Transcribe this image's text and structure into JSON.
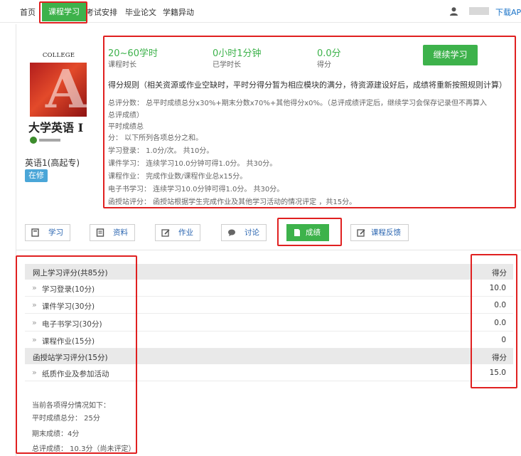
{
  "nav": {
    "items": [
      {
        "label": "首页"
      },
      {
        "label": "课程学习"
      },
      {
        "label": "考试安排"
      },
      {
        "label": "毕业论文"
      },
      {
        "label": "学籍异动"
      }
    ],
    "download": "下载APP"
  },
  "course": {
    "cover_header": "COLLEGE ENGLISH",
    "cover_letter": "A",
    "cover_title": "大学英语 I",
    "name": "英语1(高起专)",
    "status": "在修"
  },
  "stats": [
    {
      "value": "20~60学时",
      "label": "课程时长"
    },
    {
      "value": "0小时1分钟",
      "label": "已学时长"
    },
    {
      "value": "0.0分",
      "label": "得分"
    }
  ],
  "continue_label": "继续学习",
  "rules": {
    "title": "得分规则（相关资源或作业空缺时，平时分得分暂为相应模块的满分，待资源建设好后，成绩将重新按照规则计算）",
    "lines": [
      "总评分数：      总平时成绩总分x30%+期末分数x70%+其他得分x0%。（总评成绩评定后，继续学习会保存记录但不再算入",
      "总评成绩）",
      "平时成绩总",
      "分：              以下所列各项总分之和。",
      "学习登录：      1.0分/次。 共10分。",
      "课件学习：      连续学习10.0分钟可得1.0分。 共30分。",
      "课程作业：      完成作业数/课程作业总x15分。",
      "电子书学习：   连续学习10.0分钟可得1.0分。 共30分。",
      "函授站评分：   函授站根据学生完成作业及其他学习活动的情况评定 ，共15分。"
    ]
  },
  "tabs": [
    {
      "label": "学习"
    },
    {
      "label": "资料"
    },
    {
      "label": "作业"
    },
    {
      "label": "讨论"
    },
    {
      "label": "成绩"
    },
    {
      "label": "课程反馈"
    }
  ],
  "grades": {
    "online_header": "网上学习评分(共85分)",
    "score_header": "得分",
    "online_items": [
      {
        "label": "学习登录(10分)",
        "score": "10.0"
      },
      {
        "label": "课件学习(30分)",
        "score": "0.0"
      },
      {
        "label": "电子书学习(30分)",
        "score": "0.0"
      },
      {
        "label": "课程作业(15分)",
        "score": "0"
      }
    ],
    "station_header": "函授站学习评分(15分)",
    "station_score_header": "得分",
    "station_items": [
      {
        "label": "纸质作业及参加活动",
        "score": "15.0"
      }
    ]
  },
  "summary": {
    "intro": "当前各项得分情况如下：",
    "usual": "平时成绩总分： 25分",
    "final": "期末成绩：4分",
    "total": "总评成绩： 10.3分（尚未评定）"
  },
  "colors": {
    "accent_green": "#3db24b",
    "badge_blue": "#4aa6d8",
    "link_blue": "#2b66b1",
    "highlight_red": "#e02020"
  }
}
